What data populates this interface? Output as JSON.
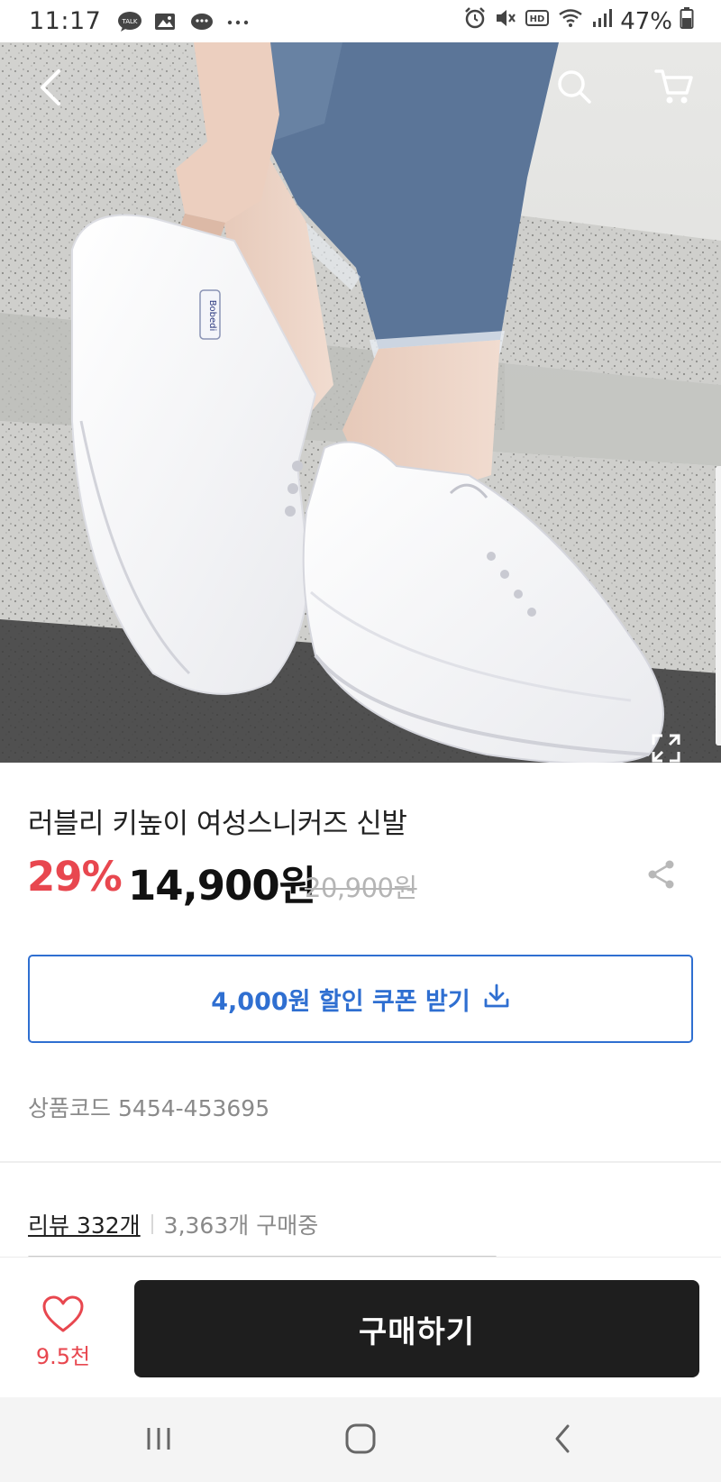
{
  "status_bar": {
    "time": "11:17",
    "battery": "47%",
    "left_icons": [
      "talk-icon",
      "image-icon",
      "chat-icon",
      "more-dots-icon"
    ],
    "right_icons": [
      "alarm-icon",
      "mute-icon",
      "hd-icon",
      "wifi-icon",
      "signal-icon",
      "battery-icon"
    ]
  },
  "hero": {
    "image_alt": "White platform sneakers worn with cropped jeans",
    "shoe_tag": "Bobedi",
    "icons": [
      "back-arrow-icon",
      "search-icon",
      "cart-icon",
      "expand-icon"
    ]
  },
  "product": {
    "title": "러블리 키높이 여성스니커즈 신발",
    "discount": "29%",
    "price": "14,900원",
    "original_price": "20,900원",
    "coupon_label": "4,000원 할인 쿠폰 받기",
    "code_label": "상품코드",
    "code_value": "5454-453695"
  },
  "reviews": {
    "link_label": "리뷰 332개",
    "buying_label": "3,363개 구매중"
  },
  "bottom_bar": {
    "like_count": "9.5천",
    "buy_label": "구매하기"
  },
  "colors": {
    "discount": "#e8474f",
    "coupon": "#2f6fd1",
    "buy_button": "#1e1e1e"
  }
}
